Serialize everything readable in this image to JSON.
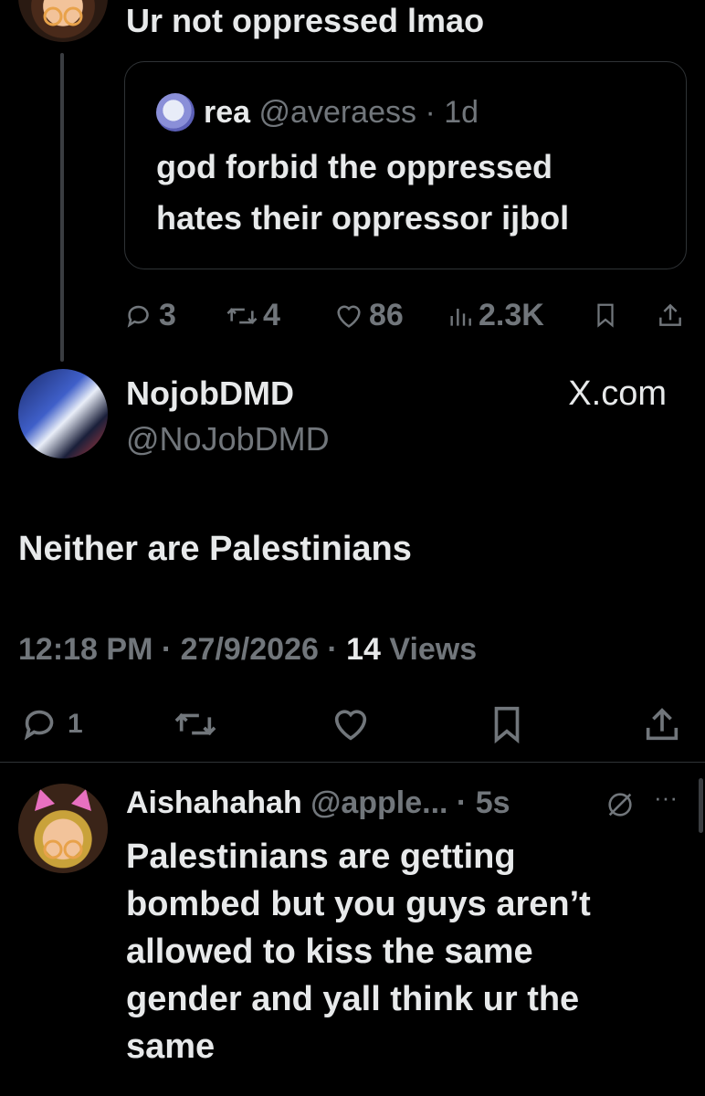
{
  "top_tweet": {
    "text": "Ur not oppressed lmao",
    "quote": {
      "name": "rea",
      "handle": "@averaess",
      "time": "1d",
      "text_line1": "god forbid the oppressed",
      "text_line2": "hates their oppressor ijbol"
    },
    "stats": {
      "replies": "3",
      "retweets": "4",
      "likes": "86",
      "views": "2.3K"
    }
  },
  "main_tweet": {
    "name": "NojobDMD",
    "handle": "@NoJobDMD",
    "source": "X.com",
    "text": "Neither are Palestinians",
    "time": "12:18 PM",
    "date": "27/9/2026",
    "views_count": "14",
    "views_label": "Views",
    "reply_count": "1"
  },
  "reply": {
    "name": "Aishahahah",
    "handle": "@apple...",
    "time": "5s",
    "more": "···",
    "lines": [
      "Palestinians are getting",
      "bombed but you guys aren’t",
      "allowed to kiss the same",
      "gender and yall think ur the",
      "same"
    ]
  },
  "colors": {
    "background": "#000000",
    "text": "#e7e9ea",
    "muted": "#71767b",
    "border": "#2f3336"
  }
}
